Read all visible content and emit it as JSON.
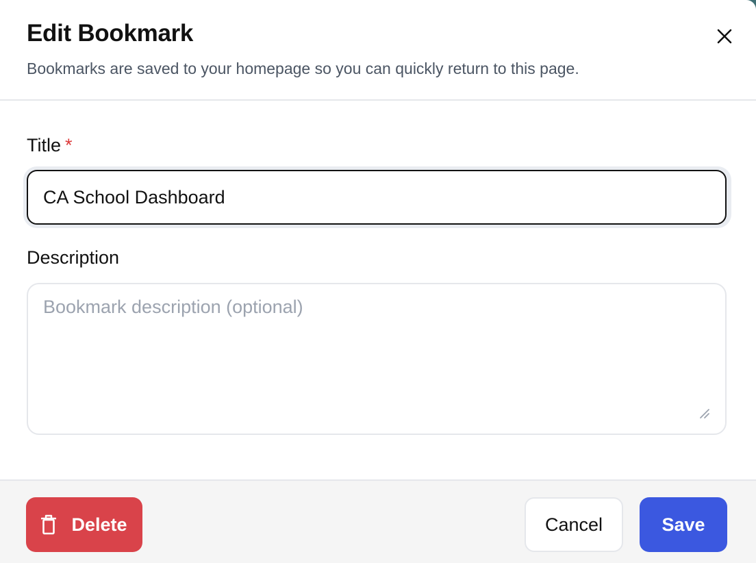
{
  "dialog": {
    "title": "Edit Bookmark",
    "subtitle": "Bookmarks are saved to your homepage so you can quickly return to this page.",
    "close_icon": "close-icon"
  },
  "form": {
    "title_label": "Title",
    "required_marker": "*",
    "title_value": "CA School Dashboard",
    "description_label": "Description",
    "description_value": "",
    "description_placeholder": "Bookmark description (optional)"
  },
  "footer": {
    "delete_label": "Delete",
    "delete_icon": "trash-icon",
    "cancel_label": "Cancel",
    "save_label": "Save"
  },
  "colors": {
    "danger": "#d9434a",
    "primary": "#3b58e0",
    "required": "#dc3b3b"
  }
}
